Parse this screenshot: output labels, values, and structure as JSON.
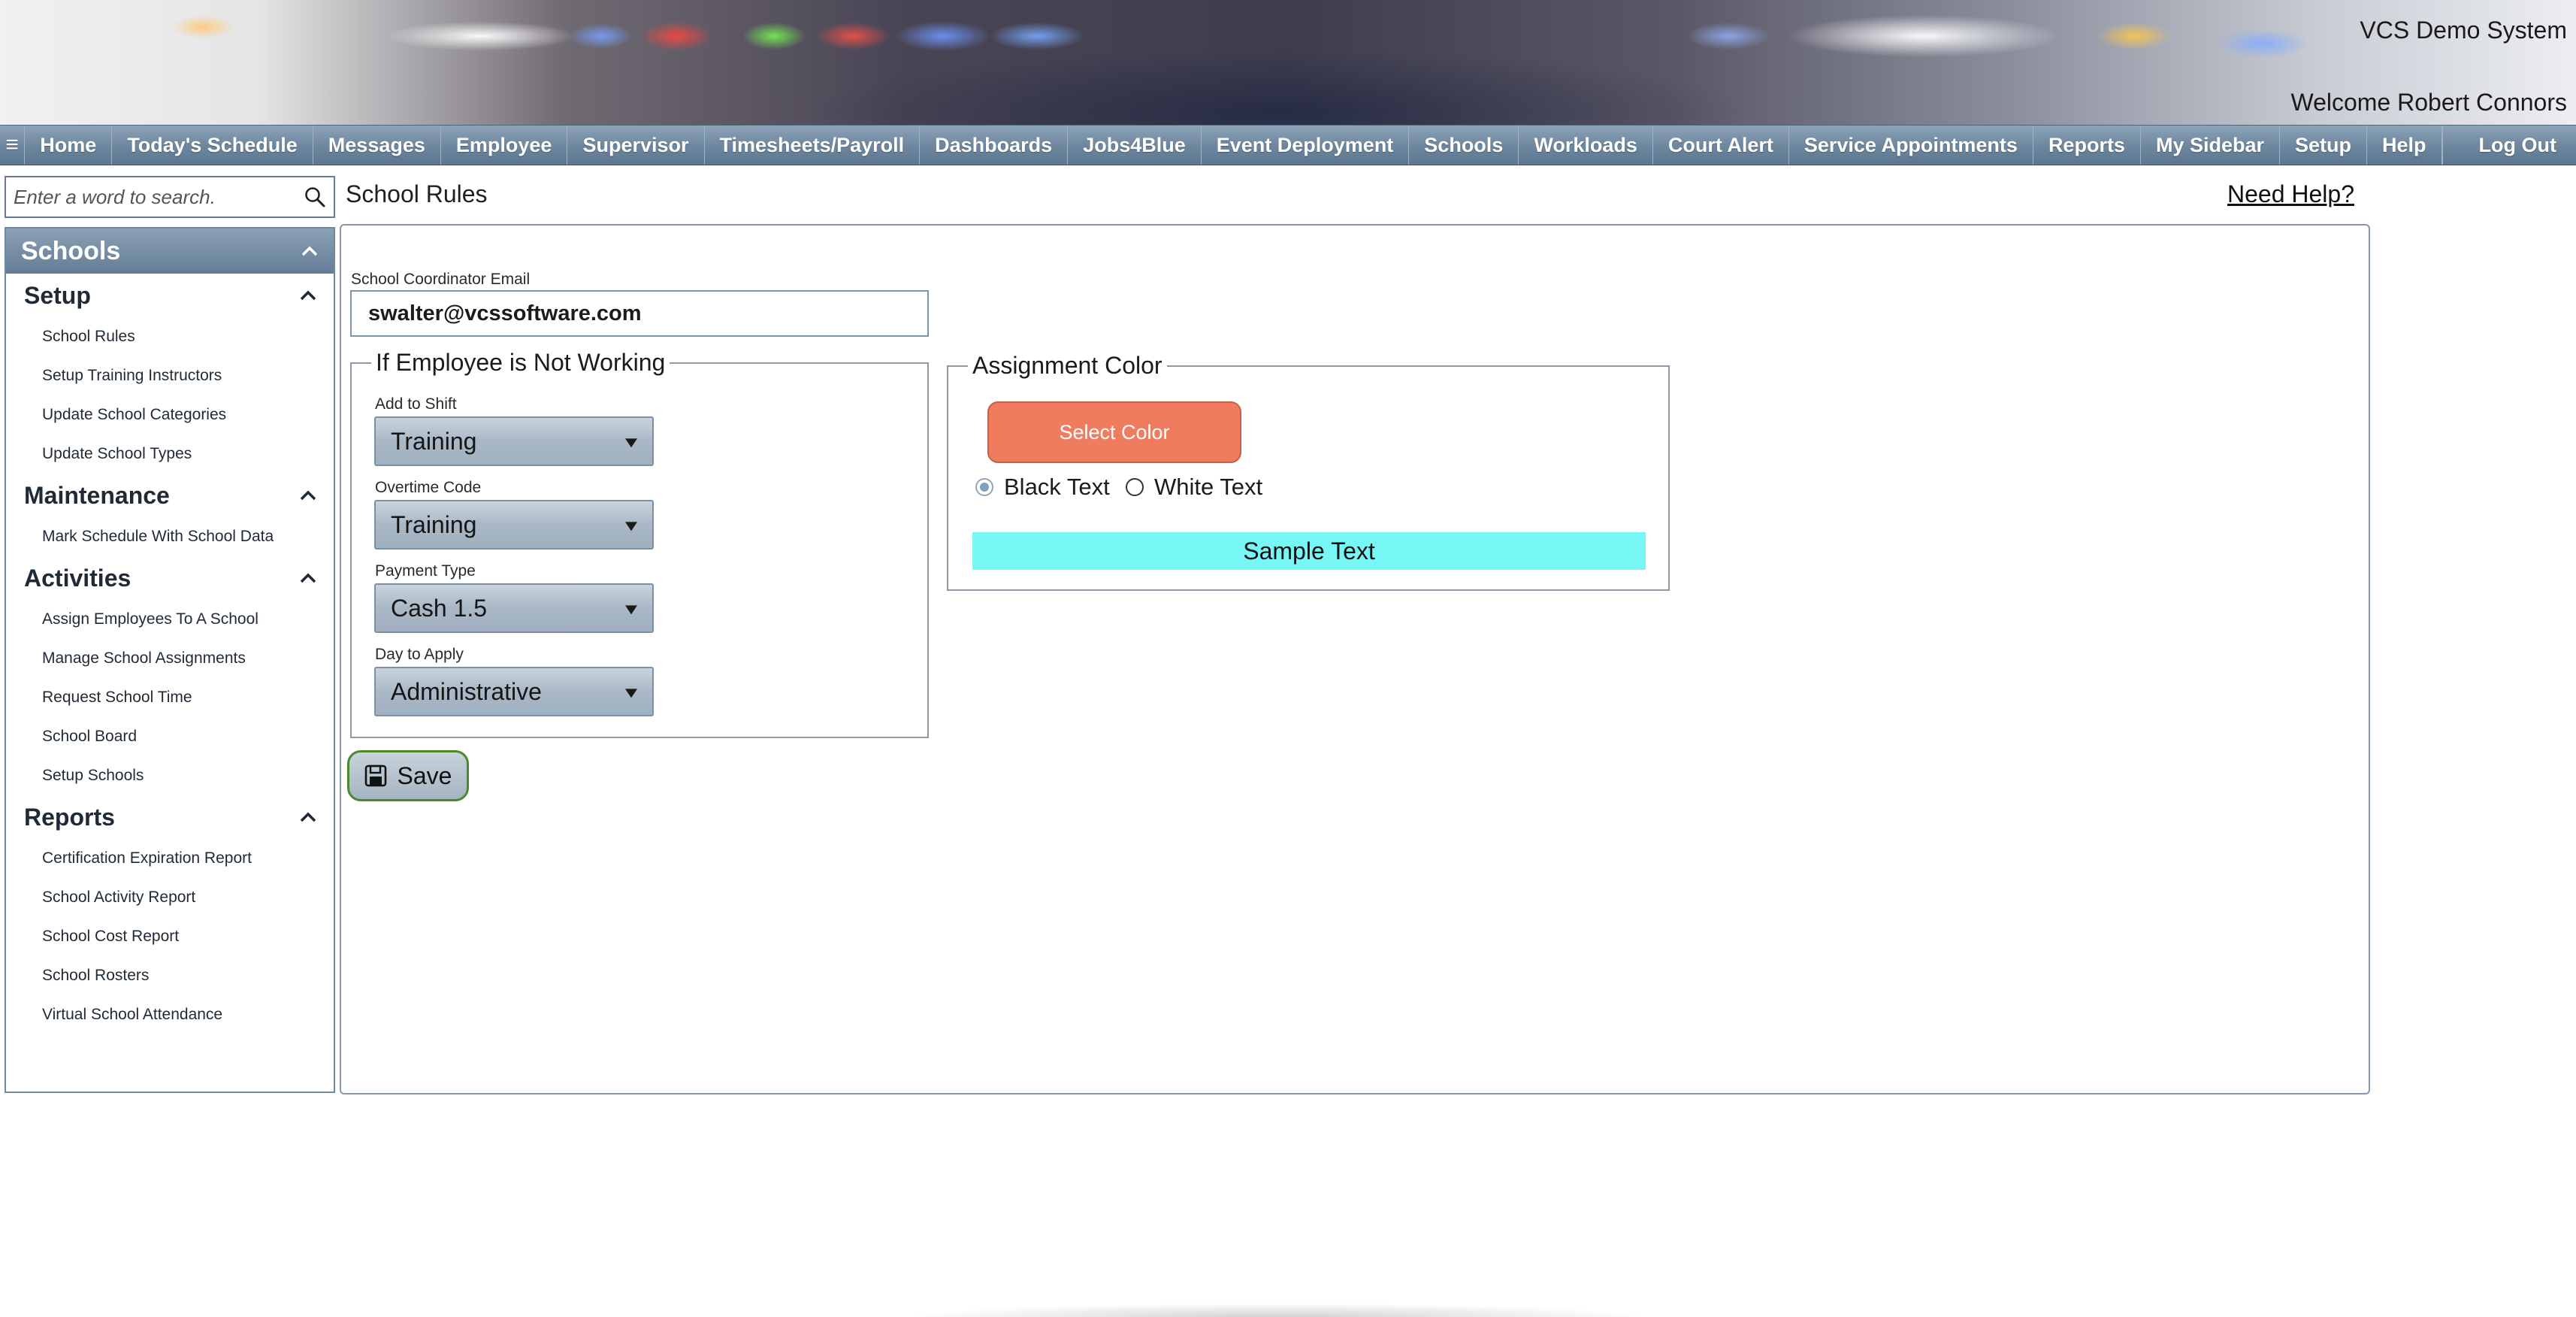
{
  "app": {
    "system_name": "VCS Demo System",
    "welcome": "Welcome Robert Connors"
  },
  "nav": {
    "menu_icon": "≡",
    "items": [
      "Home",
      "Today's Schedule",
      "Messages",
      "Employee",
      "Supervisor",
      "Timesheets/Payroll",
      "Dashboards",
      "Jobs4Blue",
      "Event Deployment",
      "Schools",
      "Workloads",
      "Court Alert",
      "Service Appointments",
      "Reports",
      "My Sidebar",
      "Setup",
      "Help"
    ],
    "logout": "Log Out"
  },
  "search": {
    "placeholder": "Enter a word to search.",
    "icon": "search-icon"
  },
  "sidebar": {
    "header": "Schools",
    "sections": [
      {
        "title": "Setup",
        "items": [
          "School Rules",
          "Setup Training Instructors",
          "Update School Categories",
          "Update School Types"
        ]
      },
      {
        "title": "Maintenance",
        "items": [
          "Mark Schedule With School Data"
        ]
      },
      {
        "title": "Activities",
        "items": [
          "Assign Employees To A School",
          "Manage School Assignments",
          "Request School Time",
          "School Board",
          "Setup Schools"
        ]
      },
      {
        "title": "Reports",
        "items": [
          "Certification Expiration Report",
          "School Activity Report",
          "School Cost Report",
          "School Rosters",
          "Virtual School Attendance"
        ]
      }
    ]
  },
  "page": {
    "title": "School Rules",
    "help_link": "Need Help?"
  },
  "form": {
    "coordinator_label": "School Coordinator Email",
    "coordinator_email": "swalter@vcssoftware.com",
    "not_working_legend": "If Employee is Not Working",
    "add_to_shift_label": "Add to Shift",
    "add_to_shift_value": "Training",
    "overtime_label": "Overtime Code",
    "overtime_value": "Training",
    "payment_label": "Payment Type",
    "payment_value": "Cash 1.5",
    "day_label": "Day to Apply",
    "day_value": "Administrative",
    "color_legend": "Assignment Color",
    "select_color": "Select Color",
    "black_text": "Black Text",
    "white_text": "White Text",
    "text_color_selected": "Black Text",
    "sample_text": "Sample Text",
    "sample_bg": "#77f6f6",
    "save": "Save"
  },
  "colors": {
    "nav_bar": "#6f88a0",
    "select_color_button": "#ef7c5e",
    "save_border": "#4b8a2c"
  }
}
